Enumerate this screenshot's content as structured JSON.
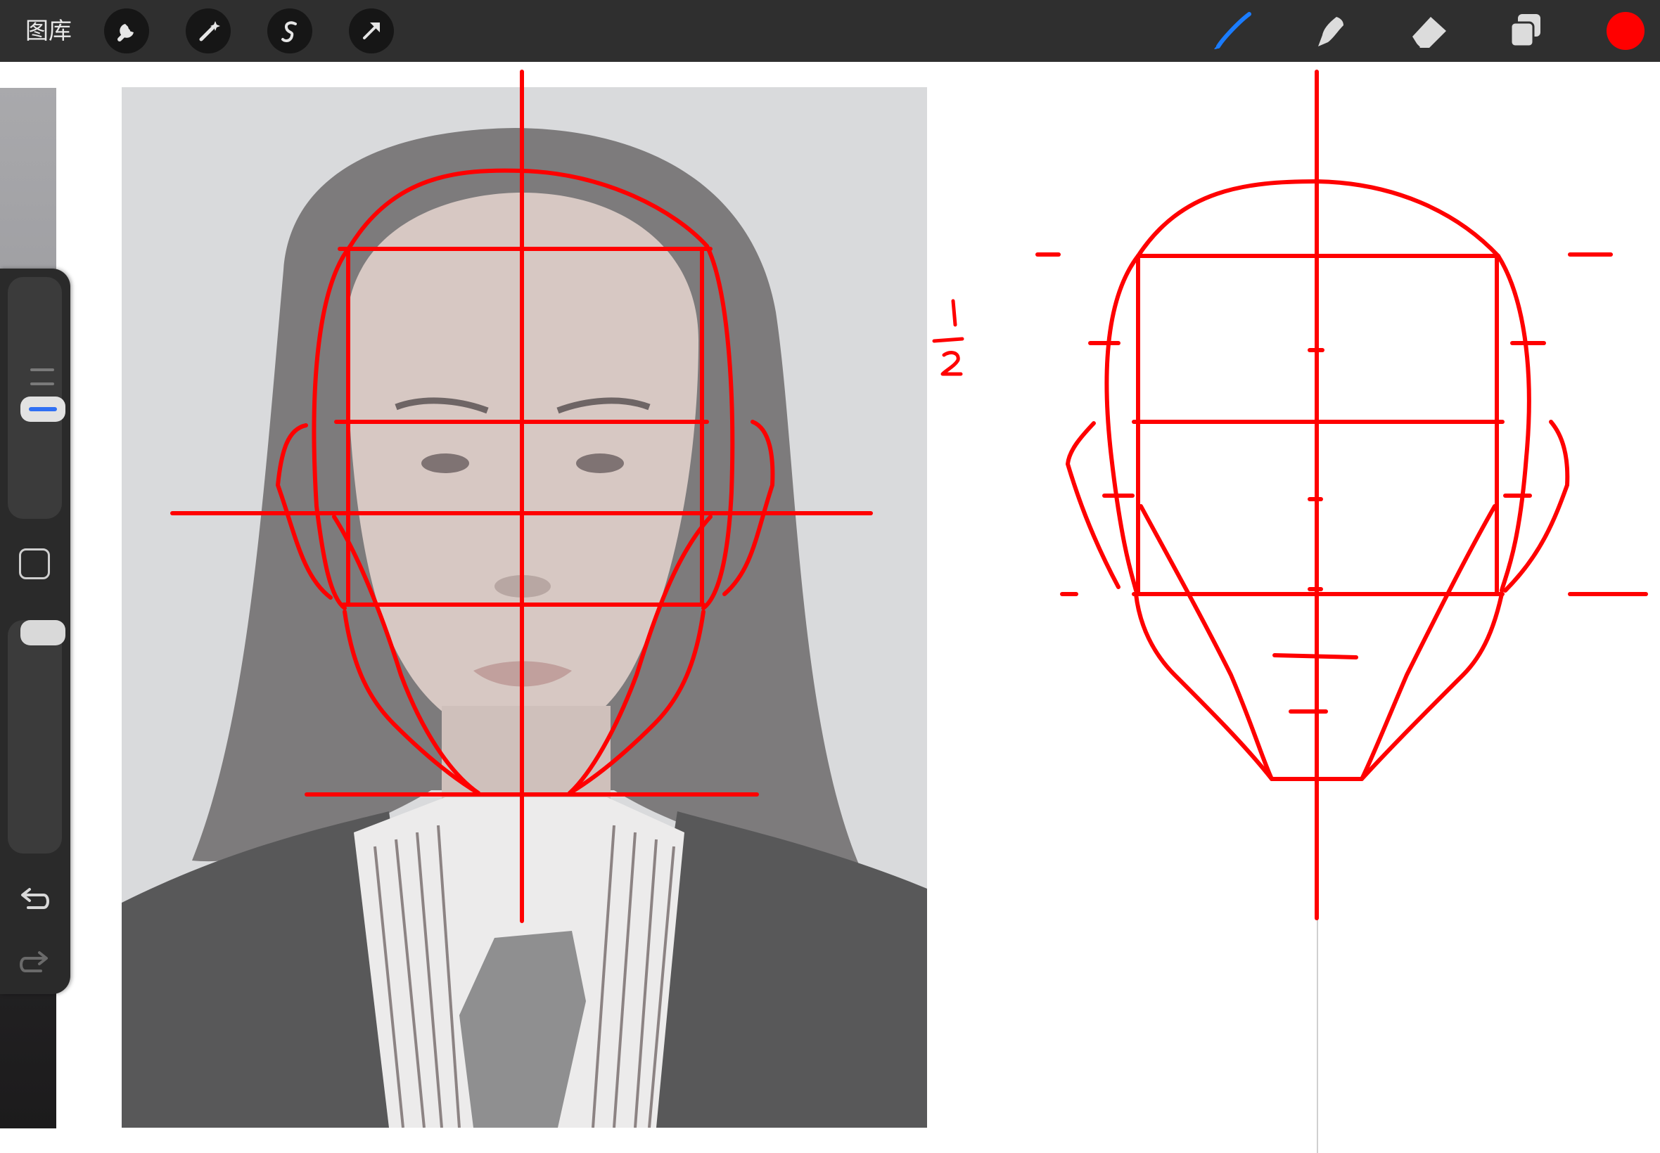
{
  "topbar": {
    "gallery_label": "图库",
    "left_tools": [
      {
        "name": "actions-wrench-icon"
      },
      {
        "name": "adjustments-magic-wand-icon"
      },
      {
        "name": "selection-s-icon"
      },
      {
        "name": "transform-arrow-icon"
      }
    ],
    "right_tools": [
      {
        "name": "brush-icon",
        "active": true,
        "color": "#1a7cff"
      },
      {
        "name": "smudge-icon",
        "active": false,
        "color": "#dcdcdc"
      },
      {
        "name": "eraser-icon",
        "active": false,
        "color": "#dcdcdc"
      },
      {
        "name": "layers-icon",
        "active": false,
        "color": "#dcdcdc"
      }
    ],
    "current_color": "#ff0000"
  },
  "sidebar": {
    "brush_size_icon": "brush-size-slider",
    "modify_icon": "square-modify-icon",
    "opacity_icon": "opacity-slider",
    "undo_icon": "undo-arrow-icon",
    "redo_icon": "redo-arrow-icon"
  },
  "canvas": {
    "reference_photo": "portrait-reference-photo",
    "annotation_text": "1/2",
    "annotation_numerator": "1",
    "annotation_denominator": "2",
    "guide_color": "#ff0000"
  }
}
